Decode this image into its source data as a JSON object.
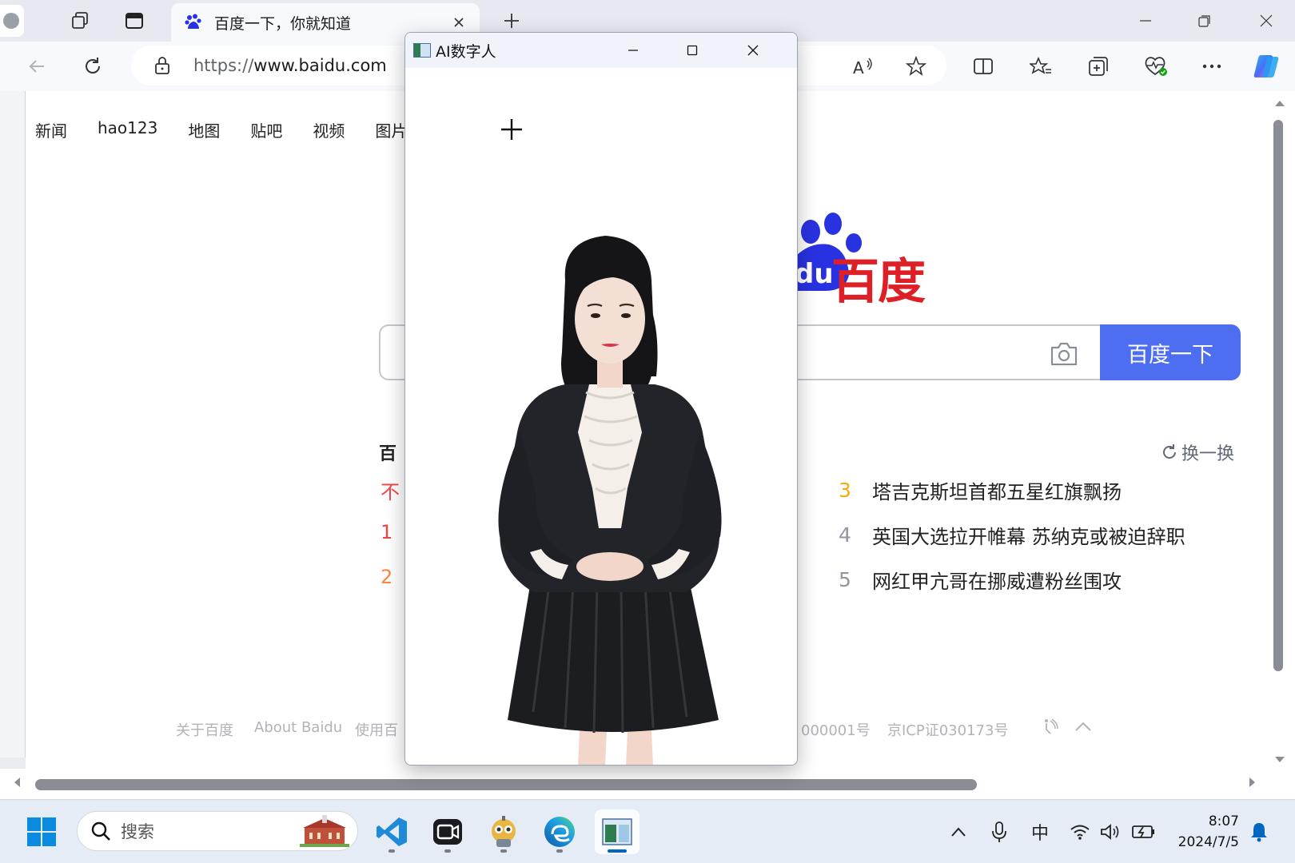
{
  "browser": {
    "tab_title": "百度一下，你就知道",
    "url_proto": "https://",
    "url_host": "www.baidu.com"
  },
  "page": {
    "nav": [
      "新闻",
      "hao123",
      "地图",
      "贴吧",
      "视频",
      "图片"
    ],
    "logo_text": "百度",
    "search_button": "百度一下",
    "hot_title": "百",
    "hot_left": [
      {
        "text": "不",
        "color": "#f54545"
      },
      {
        "text": "1",
        "color": "#f54545"
      },
      {
        "text": "2",
        "color": "#ff8547"
      }
    ],
    "refresh_label": "换一换",
    "hot_items": [
      {
        "num": "3",
        "color": "#faa90e",
        "text": "塔吉克斯坦首都五星红旗飘扬"
      },
      {
        "num": "4",
        "color": "#9195a3",
        "text": "英国大选拉开帷幕 苏纳克或被迫辞职"
      },
      {
        "num": "5",
        "color": "#9195a3",
        "text": "网红甲亢哥在挪威遭粉丝围攻"
      }
    ],
    "footer": {
      "about_cn": "关于百度",
      "about_en": "About Baidu",
      "use": "使用百",
      "license1": "000001号",
      "icp": "京ICP证030173号"
    }
  },
  "ai_window": {
    "title": "AI数字人"
  },
  "taskbar": {
    "search_label": "搜索",
    "ime": "中",
    "time": "8:07",
    "date": "2024/7/5"
  },
  "colors": {
    "accent": "#4e6ef2",
    "baidu_red": "#de1f26",
    "baidu_blue": "#2932e1"
  }
}
